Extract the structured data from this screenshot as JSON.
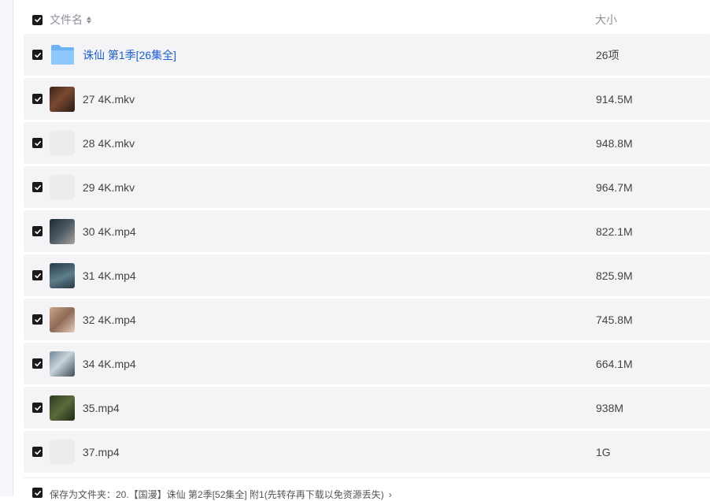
{
  "header": {
    "name_label": "文件名",
    "size_label": "大小"
  },
  "files": [
    {
      "name": "诛仙 第1季[26集全]",
      "size": "26项",
      "type": "folder",
      "thumb": "folder-icon"
    },
    {
      "name": "27 4K.mkv",
      "size": "914.5M",
      "type": "video",
      "thumb": "video-thumbnail"
    },
    {
      "name": "28 4K.mkv",
      "size": "948.8M",
      "type": "video",
      "thumb": "blank-thumbnail"
    },
    {
      "name": "29 4K.mkv",
      "size": "964.7M",
      "type": "video",
      "thumb": "blank-thumbnail"
    },
    {
      "name": "30 4K.mp4",
      "size": "822.1M",
      "type": "video",
      "thumb": "video-thumbnail"
    },
    {
      "name": "31 4K.mp4",
      "size": "825.9M",
      "type": "video",
      "thumb": "video-thumbnail"
    },
    {
      "name": "32 4K.mp4",
      "size": "745.8M",
      "type": "video",
      "thumb": "video-thumbnail"
    },
    {
      "name": "34 4K.mp4",
      "size": "664.1M",
      "type": "video",
      "thumb": "video-thumbnail"
    },
    {
      "name": "35.mp4",
      "size": "938M",
      "type": "video",
      "thumb": "video-thumbnail"
    },
    {
      "name": "37.mp4",
      "size": "1G",
      "type": "video",
      "thumb": "blank-thumbnail"
    }
  ],
  "footer": {
    "save_text": "保存为文件夹：20.【国漫】诛仙 第2季[52集全] 附1(先转存再下载以免资源丢失)",
    "chevron": "›"
  },
  "colors": {
    "checkbox": "#1a1a1a",
    "row_bg": "#f4f4f6",
    "folder_link": "#1c5fcf",
    "folder_icon": "#6cb2f5"
  }
}
